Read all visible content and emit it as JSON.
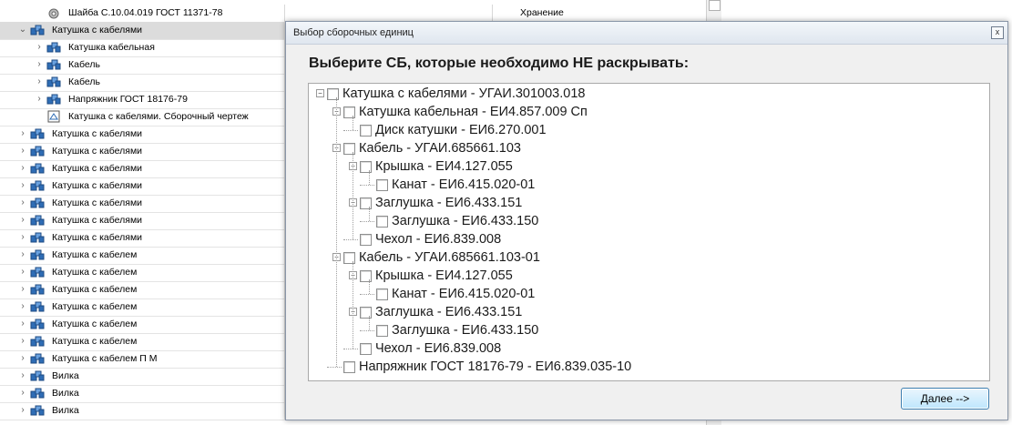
{
  "background_list": {
    "rows": [
      {
        "label": "Шайба С.10.04.019 ГОСТ 11371-78",
        "status": "Хранение",
        "indent": 1,
        "expander": "",
        "icon": "part-icon"
      },
      {
        "label": "Катушка с кабелями",
        "status": "",
        "indent": 0,
        "expander": "⌄",
        "icon": "assembly-icon"
      },
      {
        "label": "Катушка кабельная",
        "status": "",
        "indent": 1,
        "expander": "›",
        "icon": "assembly-icon"
      },
      {
        "label": "Кабель",
        "status": "",
        "indent": 1,
        "expander": "›",
        "icon": "assembly-icon"
      },
      {
        "label": "Кабель",
        "status": "",
        "indent": 1,
        "expander": "›",
        "icon": "assembly-icon"
      },
      {
        "label": "Напряжник ГОСТ 18176-79",
        "status": "",
        "indent": 1,
        "expander": "›",
        "icon": "assembly-icon"
      },
      {
        "label": "Катушка с кабелями. Сборочный чертеж",
        "status": "",
        "indent": 1,
        "expander": "",
        "icon": "drawing-icon"
      },
      {
        "label": "Катушка с кабелями",
        "status": "",
        "indent": 0,
        "expander": "›",
        "icon": "assembly-icon"
      },
      {
        "label": "Катушка с кабелями",
        "status": "",
        "indent": 0,
        "expander": "›",
        "icon": "assembly-icon"
      },
      {
        "label": "Катушка с кабелями",
        "status": "",
        "indent": 0,
        "expander": "›",
        "icon": "assembly-icon"
      },
      {
        "label": "Катушка с кабелями",
        "status": "",
        "indent": 0,
        "expander": "›",
        "icon": "assembly-icon"
      },
      {
        "label": "Катушка с кабелями",
        "status": "",
        "indent": 0,
        "expander": "›",
        "icon": "assembly-icon"
      },
      {
        "label": "Катушка с кабелями",
        "status": "",
        "indent": 0,
        "expander": "›",
        "icon": "assembly-icon"
      },
      {
        "label": "Катушка с кабелями",
        "status": "",
        "indent": 0,
        "expander": "›",
        "icon": "assembly-icon"
      },
      {
        "label": "Катушка с кабелем",
        "status": "",
        "indent": 0,
        "expander": "›",
        "icon": "assembly-icon"
      },
      {
        "label": "Катушка с кабелем",
        "status": "",
        "indent": 0,
        "expander": "›",
        "icon": "assembly-icon"
      },
      {
        "label": "Катушка с кабелем",
        "status": "",
        "indent": 0,
        "expander": "›",
        "icon": "assembly-icon"
      },
      {
        "label": "Катушка с кабелем",
        "status": "",
        "indent": 0,
        "expander": "›",
        "icon": "assembly-icon"
      },
      {
        "label": "Катушка с кабелем",
        "status": "",
        "indent": 0,
        "expander": "›",
        "icon": "assembly-icon"
      },
      {
        "label": "Катушка с кабелем",
        "status": "",
        "indent": 0,
        "expander": "›",
        "icon": "assembly-icon"
      },
      {
        "label": "Катушка с кабелем П       М",
        "status": "",
        "indent": 0,
        "expander": "›",
        "icon": "assembly-icon"
      },
      {
        "label": "Вилка",
        "status": "",
        "indent": 0,
        "expander": "›",
        "icon": "assembly-icon"
      },
      {
        "label": "Вилка",
        "status": "",
        "indent": 0,
        "expander": "›",
        "icon": "assembly-icon"
      },
      {
        "label": "Вилка",
        "status": "",
        "indent": 0,
        "expander": "›",
        "icon": "assembly-icon"
      }
    ],
    "selected_row": 1
  },
  "dialog": {
    "title": "Выбор сборочных единиц",
    "close_label": "x",
    "prompt": "Выберите СБ, которые необходимо НЕ раскрывать:",
    "next_label": "Далее -->",
    "tree": [
      {
        "label": "Катушка с кабелями - УГАИ.301003.018",
        "depth": 0,
        "toggle": "−",
        "checked": false
      },
      {
        "label": "Катушка кабельная - ЕИ4.857.009 Сп",
        "depth": 1,
        "toggle": "−",
        "checked": false
      },
      {
        "label": "Диск катушки - ЕИ6.270.001",
        "depth": 2,
        "toggle": "",
        "checked": false
      },
      {
        "label": "Кабель - УГАИ.685661.103",
        "depth": 1,
        "toggle": "−",
        "checked": false
      },
      {
        "label": "Крышка - ЕИ4.127.055",
        "depth": 2,
        "toggle": "−",
        "checked": false
      },
      {
        "label": "Канат - ЕИ6.415.020-01",
        "depth": 3,
        "toggle": "",
        "checked": false
      },
      {
        "label": "Заглушка - ЕИ6.433.151",
        "depth": 2,
        "toggle": "−",
        "checked": false
      },
      {
        "label": "Заглушка - ЕИ6.433.150",
        "depth": 3,
        "toggle": "",
        "checked": false
      },
      {
        "label": "Чехол - ЕИ6.839.008",
        "depth": 2,
        "toggle": "",
        "checked": false
      },
      {
        "label": "Кабель - УГАИ.685661.103-01",
        "depth": 1,
        "toggle": "−",
        "checked": false
      },
      {
        "label": "Крышка - ЕИ4.127.055",
        "depth": 2,
        "toggle": "−",
        "checked": false
      },
      {
        "label": "Канат - ЕИ6.415.020-01",
        "depth": 3,
        "toggle": "",
        "checked": false
      },
      {
        "label": "Заглушка - ЕИ6.433.151",
        "depth": 2,
        "toggle": "−",
        "checked": false
      },
      {
        "label": "Заглушка - ЕИ6.433.150",
        "depth": 3,
        "toggle": "",
        "checked": false
      },
      {
        "label": "Чехол - ЕИ6.839.008",
        "depth": 2,
        "toggle": "",
        "checked": false
      },
      {
        "label": "Напряжник ГОСТ 18176-79 - ЕИ6.839.035-10",
        "depth": 1,
        "toggle": "",
        "checked": false
      }
    ]
  },
  "colors": {
    "selected_row": "#dcdcdc",
    "dialog_body": "#f0f0f0",
    "button_border": "#3c7fb1",
    "assembly_icon": "#2f6db5"
  }
}
